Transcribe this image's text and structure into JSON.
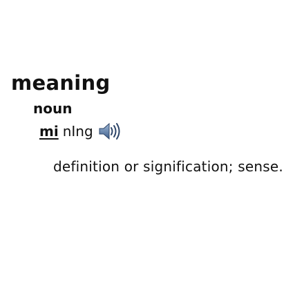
{
  "entry": {
    "headword": "meaning",
    "part_of_speech": "noun",
    "pronunciation": {
      "stressed": "mi",
      "unstressed": "nIng"
    },
    "audio_icon": "speaker-icon",
    "definition": "definition or signification; sense."
  }
}
